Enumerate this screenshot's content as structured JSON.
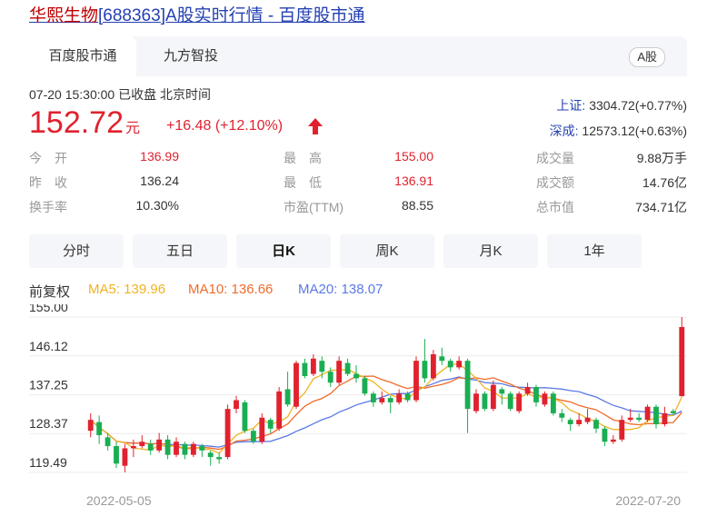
{
  "page_title": {
    "prefix": "华熙生物",
    "suffix": "[688363]A股实时行情 - 百度股市通"
  },
  "tabs": [
    {
      "label": "百度股市通",
      "active": true
    },
    {
      "label": "九方智投",
      "active": false
    }
  ],
  "market_badge": "A股",
  "quote": {
    "time_status": "07-20 15:30:00  已收盘  北京时间",
    "price": "152.72",
    "unit": "元",
    "change": "+16.48 (+12.10%)"
  },
  "indices": [
    {
      "name": "上证:",
      "value": "3304.72(+0.77%)"
    },
    {
      "name": "深成:",
      "value": "12573.12(+0.63%)"
    }
  ],
  "stats": [
    {
      "label": "今　开",
      "value": "136.99",
      "red": true
    },
    {
      "label": "最　高",
      "value": "155.00",
      "red": true
    },
    {
      "label": "成交量",
      "value": "9.88万手",
      "red": false
    },
    {
      "label": "昨　收",
      "value": "136.24",
      "red": false
    },
    {
      "label": "最　低",
      "value": "136.91",
      "red": true
    },
    {
      "label": "成交额",
      "value": "14.76亿",
      "red": false
    },
    {
      "label": "换手率",
      "value": "10.30%",
      "red": false
    },
    {
      "label": "市盈(TTM)",
      "value": "88.55",
      "red": false
    },
    {
      "label": "总市值",
      "value": "734.71亿",
      "red": false
    }
  ],
  "periods": [
    {
      "label": "分时",
      "active": false
    },
    {
      "label": "五日",
      "active": false
    },
    {
      "label": "日K",
      "active": true
    },
    {
      "label": "周K",
      "active": false
    },
    {
      "label": "月K",
      "active": false
    },
    {
      "label": "1年",
      "active": false
    }
  ],
  "ma_legend": {
    "label": "前复权",
    "ma5": "MA5: 139.96",
    "ma10": "MA10: 136.66",
    "ma20": "MA20: 138.07"
  },
  "colors": {
    "up": "#e0222f",
    "down": "#1aae52",
    "ma5": "#f0b323",
    "ma10": "#f06b2b",
    "ma20": "#5b79e6",
    "link": "#2440b3"
  },
  "chart_data": {
    "type": "candlestick",
    "y_ticks": [
      "155.00",
      "146.12",
      "137.25",
      "128.37",
      "119.49"
    ],
    "ylim": [
      119.49,
      155.0
    ],
    "x_labels": [
      "2022-05-05",
      "2022-07-20"
    ],
    "grid": true,
    "candles": [
      {
        "o": 129.0,
        "c": 131.5,
        "h": 133.0,
        "l": 127.5
      },
      {
        "o": 131.0,
        "c": 128.0,
        "h": 132.5,
        "l": 126.0
      },
      {
        "o": 127.5,
        "c": 125.5,
        "h": 128.5,
        "l": 124.5
      },
      {
        "o": 125.5,
        "c": 121.5,
        "h": 126.5,
        "l": 120.5
      },
      {
        "o": 121.0,
        "c": 125.0,
        "h": 126.0,
        "l": 119.5
      },
      {
        "o": 125.0,
        "c": 125.5,
        "h": 127.0,
        "l": 123.0
      },
      {
        "o": 125.5,
        "c": 126.5,
        "h": 128.0,
        "l": 125.0
      },
      {
        "o": 126.0,
        "c": 124.5,
        "h": 127.0,
        "l": 123.5
      },
      {
        "o": 124.5,
        "c": 127.0,
        "h": 128.5,
        "l": 124.0
      },
      {
        "o": 127.0,
        "c": 123.5,
        "h": 128.0,
        "l": 122.5
      },
      {
        "o": 123.5,
        "c": 126.5,
        "h": 127.5,
        "l": 123.0
      },
      {
        "o": 126.0,
        "c": 123.5,
        "h": 126.5,
        "l": 122.5
      },
      {
        "o": 123.5,
        "c": 126.0,
        "h": 126.5,
        "l": 123.0
      },
      {
        "o": 125.5,
        "c": 124.5,
        "h": 126.0,
        "l": 123.0
      },
      {
        "o": 124.0,
        "c": 123.0,
        "h": 124.5,
        "l": 121.0
      },
      {
        "o": 123.0,
        "c": 122.5,
        "h": 124.0,
        "l": 121.5
      },
      {
        "o": 123.0,
        "c": 134.0,
        "h": 135.0,
        "l": 122.5
      },
      {
        "o": 134.0,
        "c": 136.0,
        "h": 137.0,
        "l": 133.0
      },
      {
        "o": 135.5,
        "c": 129.0,
        "h": 136.0,
        "l": 128.5
      },
      {
        "o": 129.0,
        "c": 126.5,
        "h": 129.5,
        "l": 126.0
      },
      {
        "o": 126.5,
        "c": 132.0,
        "h": 133.0,
        "l": 126.0
      },
      {
        "o": 131.5,
        "c": 129.5,
        "h": 132.0,
        "l": 128.5
      },
      {
        "o": 129.5,
        "c": 138.0,
        "h": 139.0,
        "l": 129.0
      },
      {
        "o": 138.5,
        "c": 135.0,
        "h": 142.5,
        "l": 134.5
      },
      {
        "o": 134.5,
        "c": 144.5,
        "h": 145.0,
        "l": 134.0
      },
      {
        "o": 144.5,
        "c": 141.5,
        "h": 145.5,
        "l": 141.0
      },
      {
        "o": 142.0,
        "c": 145.5,
        "h": 146.5,
        "l": 141.5
      },
      {
        "o": 145.0,
        "c": 142.5,
        "h": 146.0,
        "l": 141.0
      },
      {
        "o": 142.5,
        "c": 140.0,
        "h": 143.5,
        "l": 139.0
      },
      {
        "o": 140.0,
        "c": 145.0,
        "h": 146.0,
        "l": 139.5
      },
      {
        "o": 144.5,
        "c": 142.0,
        "h": 145.5,
        "l": 141.5
      },
      {
        "o": 142.0,
        "c": 141.0,
        "h": 144.0,
        "l": 140.0
      },
      {
        "o": 141.0,
        "c": 137.5,
        "h": 141.5,
        "l": 137.0
      },
      {
        "o": 137.5,
        "c": 135.5,
        "h": 138.0,
        "l": 134.5
      },
      {
        "o": 135.5,
        "c": 136.5,
        "h": 138.0,
        "l": 135.0
      },
      {
        "o": 136.5,
        "c": 135.5,
        "h": 137.0,
        "l": 133.0
      },
      {
        "o": 135.5,
        "c": 137.5,
        "h": 138.5,
        "l": 135.0
      },
      {
        "o": 137.5,
        "c": 136.0,
        "h": 138.0,
        "l": 135.5
      },
      {
        "o": 136.0,
        "c": 145.0,
        "h": 146.0,
        "l": 135.5
      },
      {
        "o": 145.0,
        "c": 141.0,
        "h": 150.0,
        "l": 140.0
      },
      {
        "o": 141.0,
        "c": 146.5,
        "h": 147.5,
        "l": 140.5
      },
      {
        "o": 146.0,
        "c": 145.0,
        "h": 148.0,
        "l": 144.0
      },
      {
        "o": 145.0,
        "c": 143.5,
        "h": 145.5,
        "l": 142.5
      },
      {
        "o": 143.5,
        "c": 145.0,
        "h": 146.0,
        "l": 143.0
      },
      {
        "o": 145.0,
        "c": 134.0,
        "h": 145.5,
        "l": 128.5
      },
      {
        "o": 133.5,
        "c": 137.5,
        "h": 138.5,
        "l": 133.0
      },
      {
        "o": 137.5,
        "c": 134.0,
        "h": 138.0,
        "l": 133.5
      },
      {
        "o": 134.0,
        "c": 139.5,
        "h": 140.5,
        "l": 133.5
      },
      {
        "o": 138.5,
        "c": 137.5,
        "h": 139.0,
        "l": 135.0
      },
      {
        "o": 137.5,
        "c": 134.0,
        "h": 138.0,
        "l": 133.5
      },
      {
        "o": 133.5,
        "c": 137.5,
        "h": 138.0,
        "l": 133.0
      },
      {
        "o": 137.5,
        "c": 139.0,
        "h": 140.0,
        "l": 137.0
      },
      {
        "o": 139.0,
        "c": 135.5,
        "h": 139.5,
        "l": 134.5
      },
      {
        "o": 135.0,
        "c": 137.5,
        "h": 138.0,
        "l": 134.5
      },
      {
        "o": 137.5,
        "c": 133.0,
        "h": 138.0,
        "l": 132.5
      },
      {
        "o": 133.0,
        "c": 132.0,
        "h": 134.0,
        "l": 131.0
      },
      {
        "o": 131.5,
        "c": 130.5,
        "h": 132.0,
        "l": 129.0
      },
      {
        "o": 130.5,
        "c": 131.5,
        "h": 133.0,
        "l": 130.0
      },
      {
        "o": 131.0,
        "c": 132.0,
        "h": 134.0,
        "l": 130.5
      },
      {
        "o": 131.5,
        "c": 129.5,
        "h": 132.0,
        "l": 128.5
      },
      {
        "o": 129.5,
        "c": 126.5,
        "h": 130.0,
        "l": 125.5
      },
      {
        "o": 126.5,
        "c": 127.0,
        "h": 128.0,
        "l": 126.0
      },
      {
        "o": 127.0,
        "c": 131.5,
        "h": 132.5,
        "l": 126.5
      },
      {
        "o": 131.5,
        "c": 132.0,
        "h": 134.0,
        "l": 131.0
      },
      {
        "o": 132.0,
        "c": 131.5,
        "h": 133.0,
        "l": 131.0
      },
      {
        "o": 131.5,
        "c": 134.5,
        "h": 135.0,
        "l": 131.0
      },
      {
        "o": 134.5,
        "c": 130.5,
        "h": 135.0,
        "l": 129.5
      },
      {
        "o": 130.5,
        "c": 133.0,
        "h": 134.5,
        "l": 130.0
      },
      {
        "o": 133.5,
        "c": 133.0,
        "h": 134.0,
        "l": 132.5
      },
      {
        "o": 136.9,
        "c": 152.72,
        "h": 155.0,
        "l": 136.9
      }
    ]
  }
}
